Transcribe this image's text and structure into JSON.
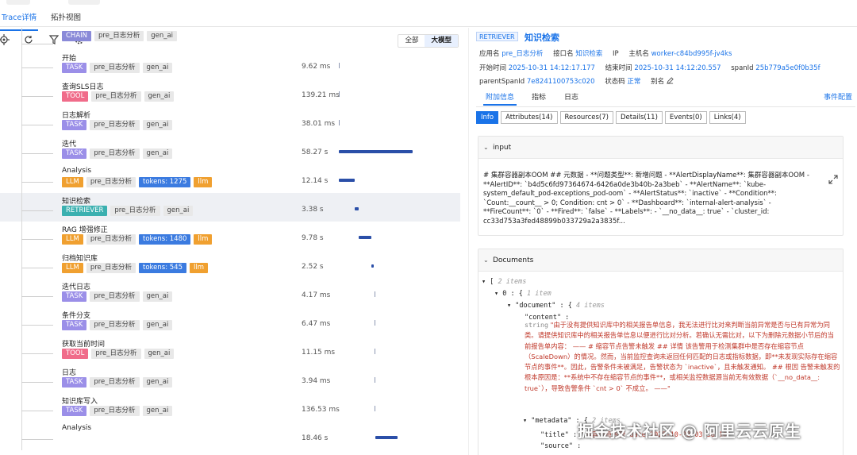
{
  "top_tabs": [
    "Trace详情",
    "拓扑视图"
  ],
  "view_toggle": [
    "全部",
    "大模型"
  ],
  "colors": {
    "accent": "#1a73e8",
    "task": "#9b8fe8",
    "tool": "#f06c8a",
    "llm": "#f0a030",
    "retriever": "#3bb0b0",
    "chain": "#8a8ad8"
  },
  "spans": [
    {
      "name": "",
      "kind": "CHAIN",
      "tags": [
        "pre_日志分析",
        "gen_ai"
      ],
      "duration": "",
      "bar_start": 0,
      "bar_width": 0
    },
    {
      "name": "开始",
      "kind": "TASK",
      "tags": [
        "pre_日志分析",
        "gen_ai"
      ],
      "duration": "9.62 ms",
      "bar_start": 0.0,
      "bar_width": 0
    },
    {
      "name": "查询SLS日志",
      "kind": "TOOL",
      "tags": [
        "pre_日志分析",
        "gen_ai"
      ],
      "duration": "139.21 ms",
      "bar_start": 0.0,
      "bar_width": 0
    },
    {
      "name": "日志解析",
      "kind": "TASK",
      "tags": [
        "pre_日志分析",
        "gen_ai"
      ],
      "duration": "38.01 ms",
      "bar_start": 0.0,
      "bar_width": 0
    },
    {
      "name": "迭代",
      "kind": "TASK",
      "tags": [
        "pre_日志分析",
        "gen_ai"
      ],
      "duration": "58.27 s",
      "bar_start": 0.0,
      "bar_width": 0.62
    },
    {
      "name": "Analysis",
      "kind": "LLM",
      "tags": [
        "pre_日志分析"
      ],
      "tokens": "tokens: 1275",
      "llm": "llm",
      "duration": "12.14 s",
      "bar_start": 0.0,
      "bar_width": 0.13
    },
    {
      "name": "知识检索",
      "kind": "RETRIEVER",
      "tags": [
        "pre_日志分析",
        "gen_ai"
      ],
      "duration": "3.38 s",
      "bar_start": 0.13,
      "bar_width": 0.035
    },
    {
      "name": "RAG 增强修正",
      "kind": "LLM",
      "tags": [
        "pre_日志分析"
      ],
      "tokens": "tokens: 1480",
      "llm": "llm",
      "duration": "9.78 s",
      "bar_start": 0.165,
      "bar_width": 0.105
    },
    {
      "name": "归档知识库",
      "kind": "LLM",
      "tags": [
        "pre_日志分析"
      ],
      "tokens": "tokens: 545",
      "llm": "llm",
      "duration": "2.52 s",
      "bar_start": 0.27,
      "bar_width": 0.026
    },
    {
      "name": "迭代日志",
      "kind": "TASK",
      "tags": [
        "pre_日志分析",
        "gen_ai"
      ],
      "duration": "4.17 ms",
      "bar_start": 0.3,
      "bar_width": 0
    },
    {
      "name": "条件分支",
      "kind": "TASK",
      "tags": [
        "pre_日志分析",
        "gen_ai"
      ],
      "duration": "6.47 ms",
      "bar_start": 0.3,
      "bar_width": 0
    },
    {
      "name": "获取当前时间",
      "kind": "TOOL",
      "tags": [
        "pre_日志分析",
        "gen_ai"
      ],
      "duration": "11.15 ms",
      "bar_start": 0.3,
      "bar_width": 0
    },
    {
      "name": "日志",
      "kind": "TASK",
      "tags": [
        "pre_日志分析",
        "gen_ai"
      ],
      "duration": "3.94 ms",
      "bar_start": 0.3,
      "bar_width": 0
    },
    {
      "name": "知识库写入",
      "kind": "TASK",
      "tags": [
        "pre_日志分析",
        "gen_ai"
      ],
      "duration": "136.53 ms",
      "bar_start": 0.3,
      "bar_width": 0
    },
    {
      "name": "Analysis",
      "kind": "",
      "tags": [],
      "duration": "18.46 s",
      "bar_start": 0.305,
      "bar_width": 0.19
    }
  ],
  "detail": {
    "badge": "RETRIEVER",
    "title": "知识检索",
    "app_label": "应用名",
    "app": "pre_日志分析",
    "iface_label": "接口名",
    "iface": "知识检索",
    "ip_label": "IP",
    "host_label": "主机名",
    "host": "worker-c84bd995f-jv4ks",
    "start_label": "开始时间",
    "start": "2025-10-31 14:12:17.177",
    "end_label": "结束时间",
    "end": "2025-10-31 14:12:20.557",
    "spanid_label": "spanId",
    "spanid": "25b779a5e0f0b35f",
    "parent_label": "parentSpanId",
    "parent": "7e8241100753c020",
    "status_label": "状态码",
    "status": "正常",
    "alias_label": "别名",
    "subtabs": [
      "附加信息",
      "指标",
      "日志"
    ],
    "event_config": "事件配置",
    "pills": [
      "Info",
      "Attributes(14)",
      "Resources(7)",
      "Details(11)",
      "Events(0)",
      "Links(4)"
    ],
    "input_title": "input",
    "input_text": "# 集群容器副本OOM ## 元数据 - **问题类型**: 新增问题 - **AlertDisplayName**: 集群容器副本OOM - **AlertID**: `b4d5c6fd97364674-6426a0de3b40b-2a3beb` - **AlertName**: `kube-system_default_pod-exceptions_pod-oom` - **AlertStatus**: `inactive` - **Condition**: `Count:__count__ > 0; Condition: cnt > 0` - **Dashboard**: `internal-alert-analysis` - **FireCount**: `0` - **Fired**: `false` - **Labels**: - `__no_data__: true` - `cluster_id: cc33d753a3fed48899b033729a2a3835f...",
    "documents_title": "Documents",
    "json": {
      "root_open": "[",
      "root_count": "2 items",
      "item0_idx": "0",
      "item0_open": "{",
      "item0_count": "1 item",
      "doc_key": "\"document\"",
      "doc_open": "{",
      "doc_count": "4 items",
      "content_key": "\"content\"",
      "content_type": "string",
      "content_value": "\"由于没有提供知识库中的相关报告单信息，我无法进行比对来判断当前异常是否与已有异常为同类。请提供知识库中的相关报告单信息以便进行比对分析。若确认无需比对，以下为删除元数据小节后的当前报告单内容： —— # 缩容节点告警未触发 ## 详情 该告警用于检测集群中是否存在缩容节点（ScaleDown）的情况。然而，当前监控查询未返回任何匹配的日志或指标数据，即**未发现实际存在缩容节点的事件**。因此，告警条件未被满足，告警状态为 `inactive`，且未触发通知。 ## 根因 告警未触发的根本原因是：**系统中不存在缩容节点的事件**，或相关监控数据源当前无有效数据（`__no_data__: true`），导致告警条件 `cnt > 0` 不成立。 ——\"",
      "metadata_key": "\"metadata\"",
      "metadata_open": "{",
      "metadata_count": "2 items",
      "title_key": "\"title\"",
      "title_value": "\"缩容节点告警 date 2025-10-28 03:38:10\"",
      "source_key": "\"source\""
    }
  },
  "watermark": "掘金技术社区 @ 阿里云云原生"
}
